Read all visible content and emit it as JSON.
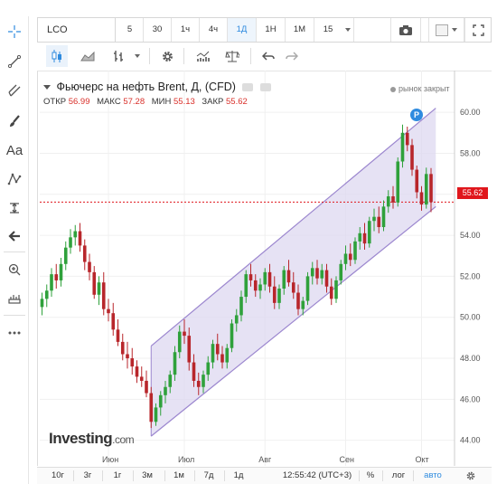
{
  "topbar": {
    "symbol": "LCO",
    "timeframes": [
      "5",
      "30",
      "1ч",
      "4ч",
      "1Д",
      "1Н",
      "1М",
      "15"
    ],
    "active_timeframe": "1Д"
  },
  "legend": {
    "title": "Фьючерс на нефть Brent, Д, (CFD)",
    "open_label": "ОТКР",
    "open": "56.99",
    "high_label": "МАКС",
    "high": "57.28",
    "low_label": "МИН",
    "low": "55.13",
    "close_label": "ЗАКР",
    "close": "55.62",
    "market_status": "рынок закрыт"
  },
  "price_axis": {
    "ticks": [
      "60.00",
      "58.00",
      "56.00",
      "54.00",
      "52.00",
      "50.00",
      "48.00",
      "46.00",
      "44.00"
    ]
  },
  "time_axis": {
    "ticks": [
      "Июн",
      "Июл",
      "Авг",
      "Сен",
      "Окт"
    ]
  },
  "last_price_label": "55.62",
  "badge": "P",
  "logo": {
    "brand": "Investing",
    "domain": ".com"
  },
  "bottombar": {
    "ranges": [
      "10г",
      "3г",
      "1г",
      "3м",
      "1м",
      "7д",
      "1д"
    ],
    "time": "12:55:42 (UTC+3)",
    "percent": "%",
    "log": "лог",
    "auto": "авто"
  },
  "colors": {
    "up": "#2fa13b",
    "down": "#b8262b",
    "channel_fill": "#ddd8f0",
    "channel_line": "#9c87cf",
    "price_line": "#e0161c",
    "accent": "#2f8bdf"
  },
  "chart_data": {
    "type": "candlestick",
    "x_ticks": [
      "Июн",
      "Июл",
      "Авг",
      "Сен",
      "Окт"
    ],
    "ylim": [
      43.5,
      60.8
    ],
    "y_ticks": [
      44,
      46,
      48,
      50,
      52,
      54,
      56,
      58,
      60
    ],
    "last_price": 55.62,
    "ohlc": [
      [
        50.5,
        51.2,
        50.1,
        50.9
      ],
      [
        50.9,
        51.6,
        50.5,
        51.3
      ],
      [
        51.3,
        52.4,
        51.0,
        52.1
      ],
      [
        52.1,
        52.6,
        51.4,
        51.8
      ],
      [
        51.8,
        52.9,
        51.5,
        52.6
      ],
      [
        52.6,
        53.7,
        52.3,
        53.4
      ],
      [
        53.4,
        54.3,
        53.1,
        53.9
      ],
      [
        53.9,
        54.5,
        53.5,
        54.2
      ],
      [
        54.2,
        54.6,
        53.2,
        53.5
      ],
      [
        53.5,
        53.8,
        52.3,
        52.7
      ],
      [
        52.7,
        53.1,
        51.8,
        52.2
      ],
      [
        52.2,
        52.5,
        50.9,
        51.1
      ],
      [
        51.1,
        52.0,
        50.6,
        51.7
      ],
      [
        51.7,
        52.2,
        50.1,
        50.4
      ],
      [
        50.4,
        50.9,
        49.8,
        50.2
      ],
      [
        50.2,
        50.7,
        49.1,
        49.4
      ],
      [
        49.4,
        49.9,
        48.6,
        48.8
      ],
      [
        48.8,
        49.2,
        47.9,
        48.2
      ],
      [
        48.2,
        48.8,
        47.5,
        48.0
      ],
      [
        48.0,
        48.5,
        47.2,
        47.6
      ],
      [
        47.6,
        47.9,
        46.8,
        47.1
      ],
      [
        47.1,
        47.6,
        46.6,
        46.9
      ],
      [
        46.9,
        47.4,
        46.1,
        46.3
      ],
      [
        46.3,
        46.6,
        44.6,
        44.9
      ],
      [
        44.9,
        45.8,
        44.7,
        45.6
      ],
      [
        45.6,
        46.4,
        45.2,
        46.2
      ],
      [
        46.2,
        46.9,
        45.8,
        46.6
      ],
      [
        46.6,
        47.4,
        46.3,
        47.2
      ],
      [
        47.2,
        48.6,
        46.9,
        48.3
      ],
      [
        48.3,
        49.6,
        48.0,
        49.3
      ],
      [
        49.3,
        49.9,
        48.7,
        49.1
      ],
      [
        49.1,
        49.5,
        47.4,
        47.8
      ],
      [
        47.8,
        48.2,
        46.6,
        46.9
      ],
      [
        46.9,
        47.3,
        46.2,
        46.6
      ],
      [
        46.6,
        47.4,
        46.3,
        47.2
      ],
      [
        47.2,
        48.1,
        46.9,
        47.8
      ],
      [
        47.8,
        48.9,
        47.5,
        48.7
      ],
      [
        48.7,
        49.2,
        47.9,
        48.2
      ],
      [
        48.2,
        48.6,
        47.5,
        47.8
      ],
      [
        47.8,
        48.7,
        47.5,
        48.5
      ],
      [
        48.5,
        49.9,
        48.3,
        49.7
      ],
      [
        49.7,
        50.4,
        49.3,
        50.1
      ],
      [
        50.1,
        51.3,
        49.8,
        51.0
      ],
      [
        51.0,
        52.3,
        50.7,
        52.1
      ],
      [
        52.1,
        52.6,
        51.5,
        51.8
      ],
      [
        51.8,
        52.1,
        51.0,
        51.3
      ],
      [
        51.3,
        51.9,
        50.9,
        51.6
      ],
      [
        51.6,
        52.4,
        51.3,
        52.2
      ],
      [
        52.2,
        52.6,
        51.2,
        51.5
      ],
      [
        51.5,
        52.0,
        50.4,
        50.7
      ],
      [
        50.7,
        51.6,
        50.4,
        51.4
      ],
      [
        51.4,
        52.5,
        51.1,
        52.3
      ],
      [
        52.3,
        52.8,
        51.5,
        51.7
      ],
      [
        51.7,
        52.2,
        50.9,
        51.2
      ],
      [
        51.2,
        51.6,
        50.1,
        50.4
      ],
      [
        50.4,
        51.0,
        50.1,
        50.8
      ],
      [
        50.8,
        52.2,
        50.6,
        52.0
      ],
      [
        52.0,
        52.7,
        51.6,
        52.4
      ],
      [
        52.4,
        52.8,
        51.6,
        51.9
      ],
      [
        51.9,
        52.6,
        51.6,
        52.3
      ],
      [
        52.3,
        52.6,
        51.2,
        51.5
      ],
      [
        51.5,
        51.9,
        50.6,
        50.9
      ],
      [
        50.9,
        52.0,
        50.7,
        51.8
      ],
      [
        51.8,
        52.8,
        51.6,
        52.6
      ],
      [
        52.6,
        53.5,
        52.3,
        53.1
      ],
      [
        53.1,
        53.6,
        52.5,
        52.8
      ],
      [
        52.8,
        53.9,
        52.6,
        53.7
      ],
      [
        53.7,
        54.4,
        53.3,
        54.1
      ],
      [
        54.1,
        54.6,
        53.3,
        53.6
      ],
      [
        53.6,
        54.9,
        53.4,
        54.7
      ],
      [
        54.7,
        55.3,
        54.2,
        54.9
      ],
      [
        54.9,
        55.4,
        54.1,
        54.4
      ],
      [
        54.4,
        55.7,
        54.2,
        55.4
      ],
      [
        55.4,
        56.2,
        55.1,
        55.9
      ],
      [
        55.9,
        56.4,
        55.3,
        55.6
      ],
      [
        55.6,
        57.8,
        55.4,
        57.6
      ],
      [
        57.6,
        59.4,
        57.3,
        59.0
      ],
      [
        59.0,
        59.3,
        58.1,
        58.4
      ],
      [
        58.4,
        58.7,
        56.9,
        57.2
      ],
      [
        57.2,
        57.4,
        55.8,
        56.1
      ],
      [
        56.1,
        56.4,
        55.2,
        55.5
      ],
      [
        55.5,
        57.3,
        55.3,
        56.99
      ],
      [
        56.99,
        57.28,
        55.13,
        55.62
      ]
    ],
    "channel": {
      "lower": [
        [
          23,
          44.2
        ],
        [
          83,
          55.4
        ]
      ],
      "upper": [
        [
          23,
          48.6
        ],
        [
          83,
          60.2
        ]
      ]
    }
  }
}
